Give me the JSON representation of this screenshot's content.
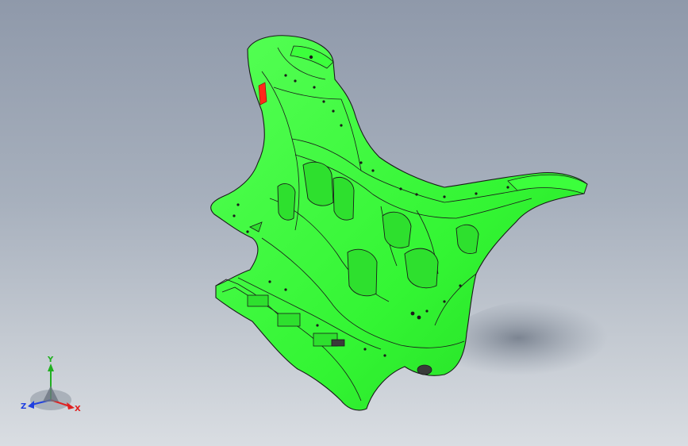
{
  "viewport": {
    "background_top": "#8f99aa",
    "background_bottom": "#d9dde2"
  },
  "model": {
    "part_color": "#33ff33",
    "edge_color": "#1a1a1a",
    "selected_face_color": "#ff2a1a",
    "shadow_color": "#7e8794"
  },
  "triad": {
    "x_label": "X",
    "y_label": "Y",
    "z_label": "Z",
    "x_color": "#e02020",
    "y_color": "#20b020",
    "z_color": "#2040e0"
  }
}
